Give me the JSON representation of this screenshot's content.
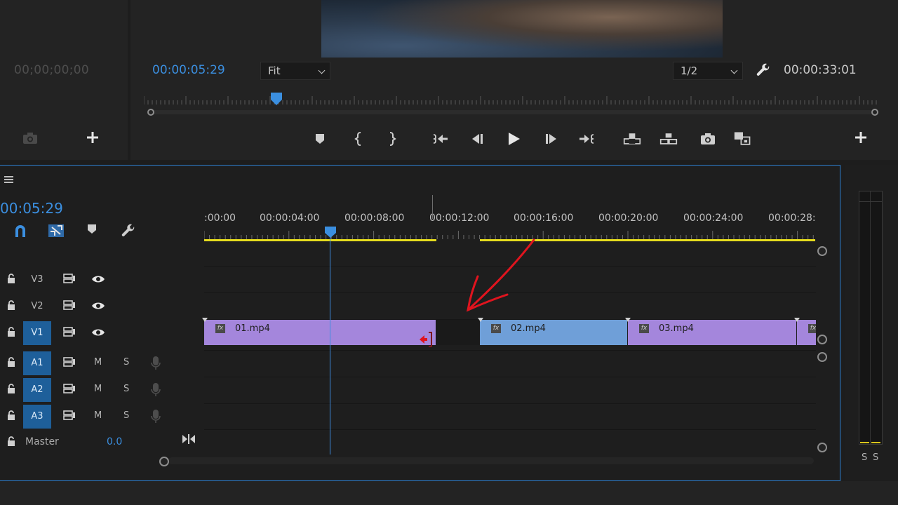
{
  "source_monitor": {
    "timecode": "00;00;00;00",
    "icons": [
      "camera-icon",
      "plus-icon"
    ]
  },
  "program_monitor": {
    "timecode": "00:00:05:29",
    "zoom": "Fit",
    "resolution": "1/2",
    "duration": "00:00:33:01",
    "transport_icons": [
      "marker-icon",
      "mark-in-icon",
      "mark-out-icon",
      "go-to-in-icon",
      "step-back-icon",
      "play-icon",
      "step-forward-icon",
      "go-to-out-icon",
      "lift-icon",
      "extract-icon",
      "export-frame-icon",
      "compare-icon",
      "plus-icon"
    ]
  },
  "timeline": {
    "timecode": "00:05:29",
    "ruler_labels": [
      ":00:00",
      "00:00:04:00",
      "00:00:08:00",
      "00:00:12:00",
      "00:00:16:00",
      "00:00:20:00",
      "00:00:24:00",
      "00:00:28:"
    ],
    "tools": [
      "snap-icon",
      "linked-selection-icon",
      "add-marker-icon",
      "timeline-settings-icon"
    ],
    "video_tracks": [
      {
        "name": "V3",
        "active": false
      },
      {
        "name": "V2",
        "active": false
      },
      {
        "name": "V1",
        "active": true
      }
    ],
    "audio_tracks": [
      {
        "name": "A1",
        "m": "M",
        "s": "S"
      },
      {
        "name": "A2",
        "m": "M",
        "s": "S"
      },
      {
        "name": "A3",
        "m": "M",
        "s": "S"
      }
    ],
    "master": {
      "label": "Master",
      "value": "0.0"
    },
    "clips": [
      {
        "name": "01.mp4",
        "fx": "fx",
        "color": "#a486dc"
      },
      {
        "name": "02.mp4",
        "fx": "fx",
        "color": "#6f9fd8"
      },
      {
        "name": "03.mp4",
        "fx": "fx",
        "color": "#a486dc"
      },
      {
        "name": "",
        "fx": "fx",
        "color": "#a486dc"
      }
    ]
  },
  "audio_meter": {
    "left_solo": "S",
    "right_solo": "S",
    "level_color": "#d8c41c"
  },
  "colors": {
    "accent": "#3b8fe0",
    "work_area": "#e6dc1e",
    "annotation": "#e0141e"
  }
}
